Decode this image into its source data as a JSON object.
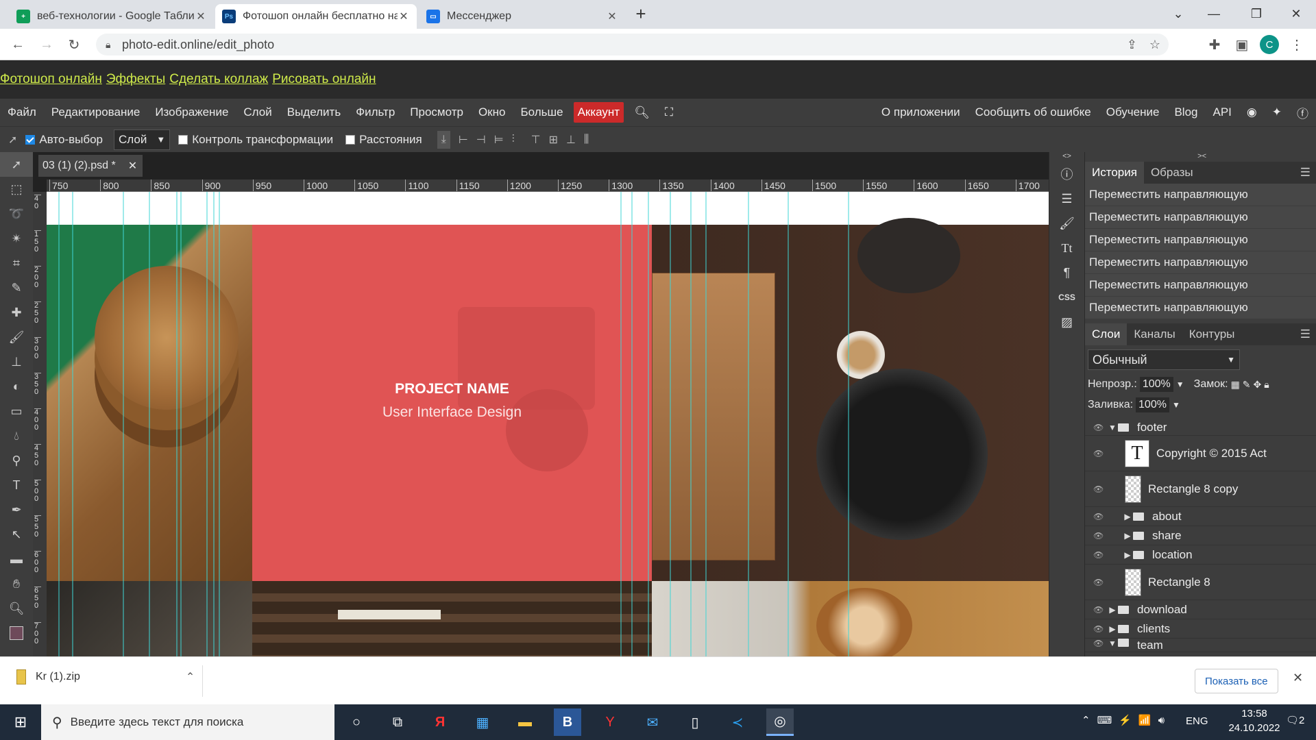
{
  "browser": {
    "tabs": [
      {
        "title": "веб-технологии - Google Табли",
        "favicon": "sheets-icon",
        "active": false
      },
      {
        "title": "Фотошоп онлайн бесплатно на",
        "favicon": "ps-icon",
        "active": true
      },
      {
        "title": "Мессенджер",
        "favicon": "messenger-icon",
        "active": false
      }
    ],
    "new_tab": "+",
    "url": "photo-edit.online/edit_photo",
    "profile_initial": "C"
  },
  "site_links": [
    "Фотошоп онлайн",
    "Эффекты",
    "Сделать коллаж",
    "Рисовать онлайн"
  ],
  "menu": {
    "items": [
      "Файл",
      "Редактирование",
      "Изображение",
      "Слой",
      "Выделить",
      "Фильтр",
      "Просмотр",
      "Окно",
      "Больше"
    ],
    "account": "Аккаунт",
    "right": [
      "О приложении",
      "Сообщить об ошибке",
      "Обучение",
      "Blog",
      "API"
    ]
  },
  "options": {
    "autoselect": "Авто-выбор",
    "autoselect_checked": true,
    "layer_select": "Слой",
    "transform": "Контроль трансформации",
    "distances": "Расстояния"
  },
  "document": {
    "tab_title": "03 (1) (2).psd *",
    "ruler_h": [
      "750",
      "800",
      "850",
      "900",
      "950",
      "1000",
      "1050",
      "1100",
      "1150",
      "1200",
      "1250",
      "1300",
      "1350",
      "1400",
      "1450",
      "1500",
      "1550",
      "1600",
      "1650",
      "1700"
    ],
    "ruler_v": [
      "40",
      "150",
      "200",
      "250",
      "300",
      "350",
      "400",
      "450",
      "500",
      "550",
      "600",
      "650",
      "700"
    ],
    "project_name": "PROJECT NAME",
    "project_sub": "User Interface Design",
    "accent_color": "#e25858"
  },
  "history": {
    "tabs": [
      "История",
      "Образы"
    ],
    "items": [
      "Переместить направляющую",
      "Переместить направляющую",
      "Переместить направляющую",
      "Переместить направляющую",
      "Переместить направляющую",
      "Переместить направляющую"
    ]
  },
  "layers": {
    "tabs": [
      "Слои",
      "Каналы",
      "Контуры"
    ],
    "blend_mode": "Обычный",
    "opacity_label": "Непрозр.:",
    "opacity": "100%",
    "lock_label": "Замок:",
    "fill_label": "Заливка:",
    "fill": "100%",
    "items": [
      {
        "name": "footer",
        "type": "folder",
        "expanded": true,
        "indent": 0
      },
      {
        "name": "Copyright © 2015 Act",
        "type": "text",
        "indent": 1
      },
      {
        "name": "Rectangle 8 copy",
        "type": "raster",
        "indent": 1
      },
      {
        "name": "about",
        "type": "folder",
        "expanded": false,
        "indent": 1
      },
      {
        "name": "share",
        "type": "folder",
        "expanded": false,
        "indent": 1
      },
      {
        "name": "location",
        "type": "folder",
        "expanded": false,
        "indent": 1
      },
      {
        "name": "Rectangle 8",
        "type": "raster",
        "indent": 1
      },
      {
        "name": "download",
        "type": "folder",
        "expanded": false,
        "indent": 0
      },
      {
        "name": "clients",
        "type": "folder",
        "expanded": false,
        "indent": 0
      },
      {
        "name": "team",
        "type": "folder",
        "expanded": true,
        "indent": 0
      }
    ]
  },
  "downloads": {
    "file": "Kr (1).zip",
    "show_all": "Показать все"
  },
  "taskbar": {
    "search_placeholder": "Введите здесь текст для поиска",
    "lang": "ENG",
    "time": "13:58",
    "date": "24.10.2022",
    "notif_count": "2"
  }
}
